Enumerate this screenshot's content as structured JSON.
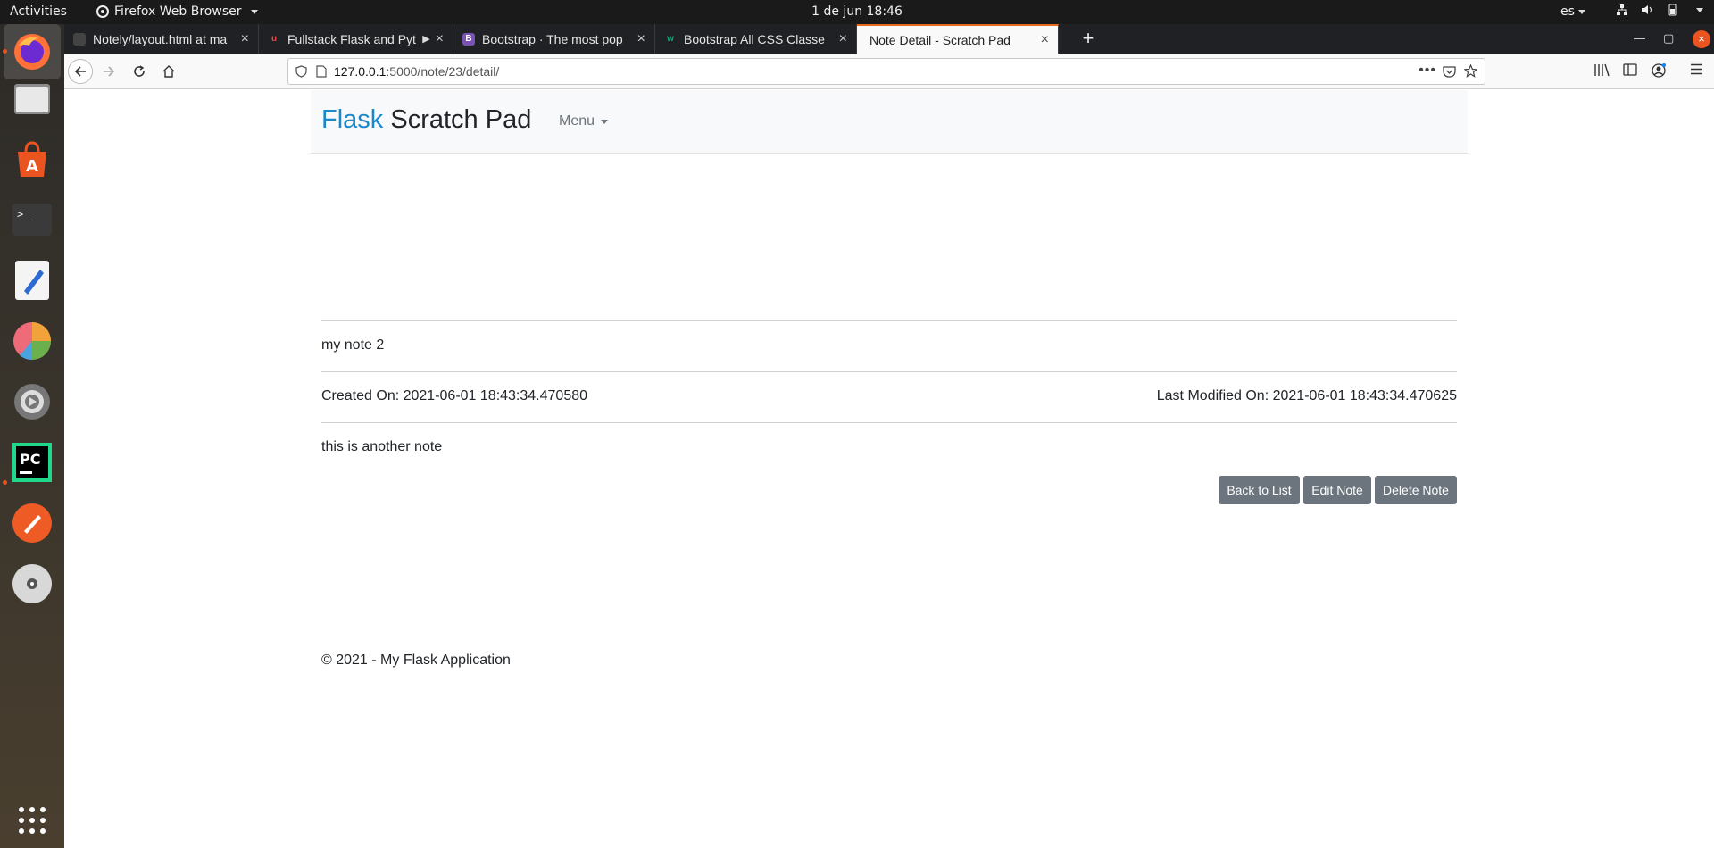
{
  "system": {
    "activities": "Activities",
    "app_menu": "Firefox Web Browser",
    "clock": "1 de jun  18:46",
    "language": "es"
  },
  "dock": {
    "items": [
      {
        "name": "firefox",
        "icon": "firefox-icon"
      },
      {
        "name": "files",
        "icon": "files-icon"
      },
      {
        "name": "software",
        "icon": "software-center-icon"
      },
      {
        "name": "terminal",
        "icon": "terminal-icon"
      },
      {
        "name": "text-editor",
        "icon": "text-editor-icon"
      },
      {
        "name": "disk-usage",
        "icon": "pie-chart-icon"
      },
      {
        "name": "settings",
        "icon": "settings-icon"
      },
      {
        "name": "pycharm",
        "icon": "pycharm-icon"
      },
      {
        "name": "postman",
        "icon": "postman-icon"
      },
      {
        "name": "disc",
        "icon": "disc-icon"
      }
    ],
    "show_apps_icon": "grid-icon"
  },
  "browser": {
    "tabs": [
      {
        "title": "Notely/layout.html at ma",
        "favicon": "github-icon",
        "favicon_color": "#444444"
      },
      {
        "title": "Fullstack Flask and Pyt",
        "favicon": "udemy-icon",
        "favicon_color": "#a435f0"
      },
      {
        "title": "Bootstrap · The most pop",
        "favicon": "bootstrap-icon",
        "favicon_color": "#7952b3"
      },
      {
        "title": "Bootstrap All CSS Classe",
        "favicon": "w3-icon",
        "favicon_color": "#0aa37a"
      },
      {
        "title": "Note Detail - Scratch Pad",
        "favicon": "",
        "favicon_color": ""
      }
    ],
    "new_tab": "+",
    "url_host": "127.0.0.1",
    "url_path": ":5000/note/23/detail/"
  },
  "page": {
    "brand_accent": "Flask",
    "brand_rest": " Scratch Pad",
    "menu_label": "Menu",
    "note_title": "my note 2",
    "created_on": "Created On: 2021-06-01 18:43:34.470580",
    "last_modified_on": "Last Modified On: 2021-06-01 18:43:34.470625",
    "note_body": "this is another note",
    "buttons": {
      "back": "Back to List",
      "edit": "Edit Note",
      "delete": "Delete Note"
    },
    "footer": "© 2021 - My Flask Application"
  },
  "colors": {
    "brand_accent": "#1a88c9",
    "button_bg": "#6c757d",
    "tab_accent": "#e66d1f",
    "ubuntu_orange": "#e95420"
  }
}
